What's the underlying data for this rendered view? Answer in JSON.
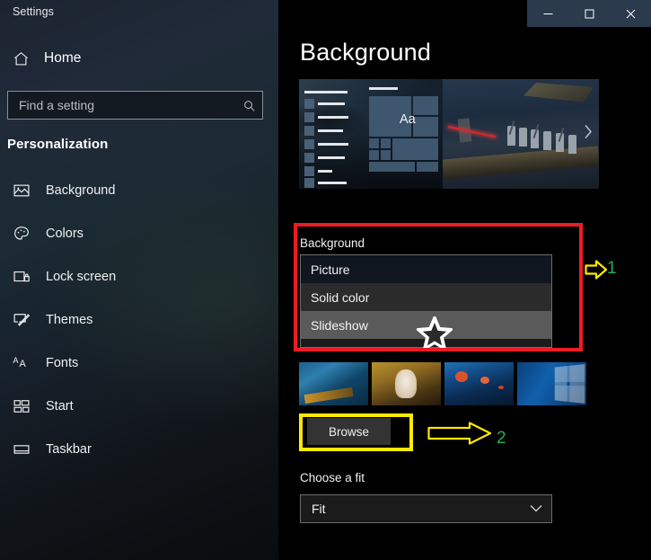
{
  "window": {
    "title": "Settings",
    "controls": [
      {
        "name": "minimize-button",
        "glyph": "minimize"
      },
      {
        "name": "maximize-button",
        "glyph": "maximize"
      },
      {
        "name": "close-button",
        "glyph": "close"
      }
    ]
  },
  "sidebar": {
    "home_label": "Home",
    "home_icon": "home-icon",
    "search": {
      "placeholder": "Find a setting",
      "value": "",
      "icon": "search-icon"
    },
    "section_title": "Personalization",
    "items": [
      {
        "label": "Background",
        "icon": "picture-icon"
      },
      {
        "label": "Colors",
        "icon": "palette-icon"
      },
      {
        "label": "Lock screen",
        "icon": "lock-screen-icon"
      },
      {
        "label": "Themes",
        "icon": "theme-brush-icon"
      },
      {
        "label": "Fonts",
        "icon": "fonts-aa-icon"
      },
      {
        "label": "Start",
        "icon": "start-tiles-icon"
      },
      {
        "label": "Taskbar",
        "icon": "taskbar-icon"
      }
    ]
  },
  "main": {
    "heading": "Background",
    "preview": {
      "tile_text": "Aa",
      "next_icon": "chevron-right-icon"
    },
    "background_section": {
      "label": "Background",
      "dropdown_open": true,
      "selected_value": "Picture",
      "hovered_value": "Slideshow",
      "options": [
        {
          "label": "Picture",
          "state": "selected"
        },
        {
          "label": "Solid color",
          "state": "normal"
        },
        {
          "label": "Slideshow",
          "state": "hovered"
        }
      ]
    },
    "choose_picture": {
      "thumbnails": [
        {
          "name": "thumb-water-boat"
        },
        {
          "name": "thumb-white-dog"
        },
        {
          "name": "thumb-underwater-coral"
        },
        {
          "name": "thumb-windows-logo"
        }
      ],
      "browse_label": "Browse"
    },
    "choose_fit": {
      "label": "Choose a fit",
      "value": "Fit",
      "chevron": "chevron-down-icon"
    }
  },
  "annotations": {
    "red_box_target": "Background",
    "yellow_box_target": "Browse",
    "markers": [
      {
        "number": "1",
        "arrow": "arrow-right-icon",
        "color": "#22b14c"
      },
      {
        "number": "2",
        "arrow": "arrow-right-icon",
        "color": "#22b14c"
      }
    ],
    "cursor_icon": "star-cursor-icon",
    "colors": {
      "red": "#ed1c24",
      "yellow": "#ffe800",
      "green": "#22b14c"
    }
  }
}
